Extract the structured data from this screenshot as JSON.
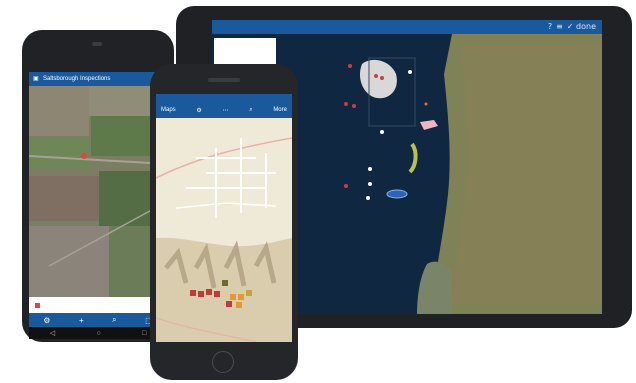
{
  "tablet": {
    "callout_text": "",
    "toolbar_icons": [
      "?",
      "≡",
      "✓ done"
    ]
  },
  "phone_left": {
    "title": "Saltsborough Inspections",
    "card_line1": "",
    "card_line2": "",
    "toolbar_icons": [
      "⚙",
      "+",
      "⌕",
      "⬚"
    ],
    "nav_icons": [
      "◁",
      "○",
      "□"
    ]
  },
  "phone_front": {
    "status_time": "",
    "left_label": "Maps",
    "right_label": "More",
    "icons": [
      "⚙",
      "⌕",
      "⋯"
    ]
  },
  "colors": {
    "app_blue": "#1a5a9c",
    "sea": "#0f2740",
    "land": "#8a8a5a",
    "basemap": "#efe9d8"
  }
}
